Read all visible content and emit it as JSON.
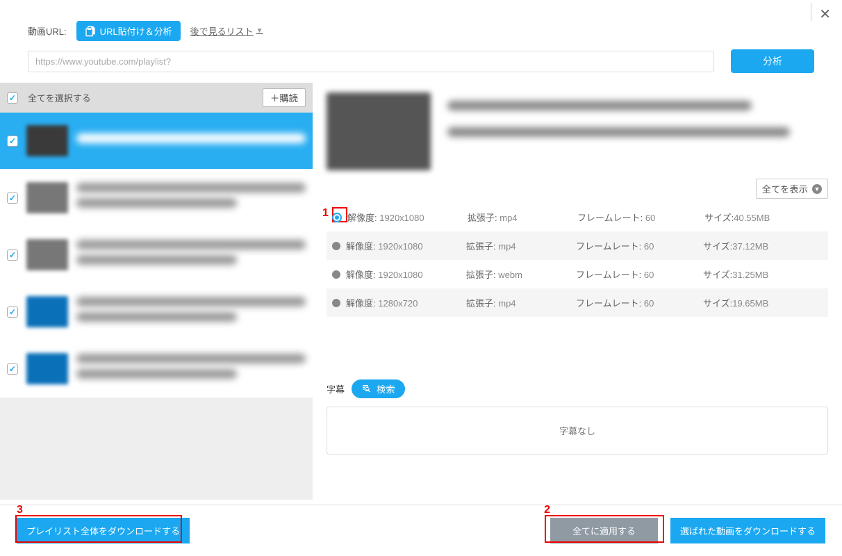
{
  "header": {
    "url_label": "動画URL:",
    "paste_analyze": "URL貼付け＆分析",
    "watch_later": "後で見るリスト",
    "url_value": "https://www.youtube.com/playlist?",
    "analyze": "分析"
  },
  "sidebar": {
    "select_all": "全てを選択する",
    "subscribe": "＋購読"
  },
  "detail": {
    "show_all": "全てを表示",
    "labels": {
      "res": "解像度:",
      "ext": "拡張子:",
      "fps": "フレームレート:",
      "size": "サイズ:"
    },
    "formats": [
      {
        "res": "1920x1080",
        "ext": "mp4",
        "fps": "60",
        "size": "40.55MB",
        "selected": true
      },
      {
        "res": "1920x1080",
        "ext": "mp4",
        "fps": "60",
        "size": "37.12MB",
        "selected": false
      },
      {
        "res": "1920x1080",
        "ext": "webm",
        "fps": "60",
        "size": "31.25MB",
        "selected": false
      },
      {
        "res": "1280x720",
        "ext": "mp4",
        "fps": "60",
        "size": "19.65MB",
        "selected": false
      }
    ],
    "subtitle_label": "字幕",
    "search": "検索",
    "no_subtitle": "字幕なし"
  },
  "footer": {
    "download_playlist": "プレイリスト全体をダウンロードする",
    "apply_all": "全てに適用する",
    "download_selected": "選ばれた動画をダウンロードする"
  },
  "annotations": {
    "a1": "1",
    "a2": "2",
    "a3": "3"
  }
}
